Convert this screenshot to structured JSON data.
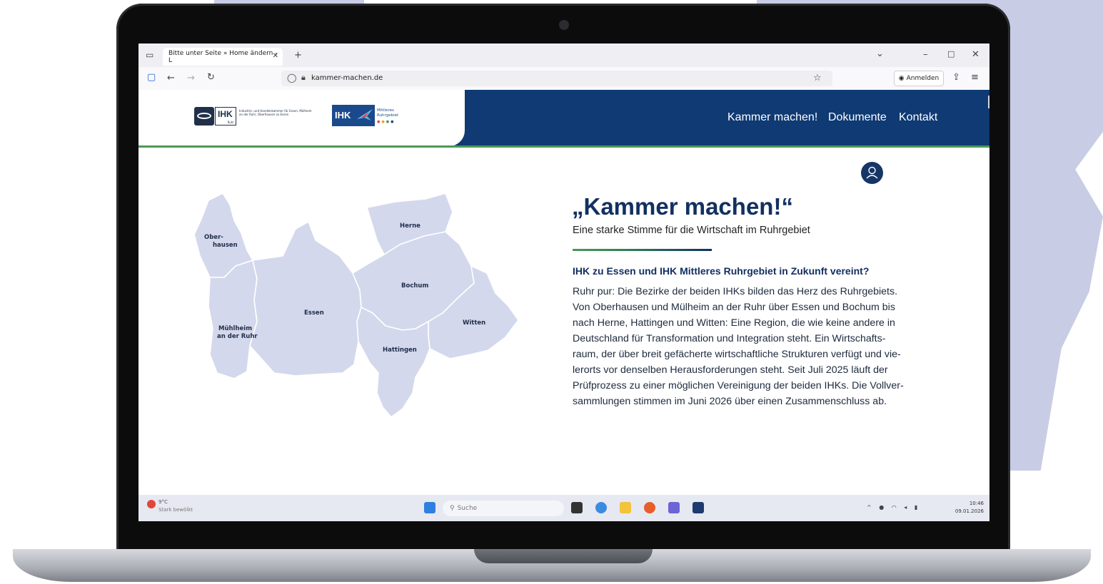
{
  "browser": {
    "tab_title": "Bitte unter Seite » Home ändern - L",
    "tab_close": "✕",
    "new_tab": "+",
    "url": "kammer-machen.de",
    "sign_in_label": "Anmelden",
    "window_controls": [
      "⌄",
      "–",
      "□",
      "✕"
    ]
  },
  "site": {
    "logo_ihk_ruhr": {
      "mark": "IHK",
      "sub": "Ruhr",
      "text": "Industrie- und Handelskammer für Essen, Mülheim an der Ruhr, Oberhausen zu Essen"
    },
    "logo_ihk_mittleres": {
      "mark": "IHK",
      "text_line1": "Mittleres",
      "text_line2": "Ruhrgebiet"
    },
    "nav": [
      "Kammer machen!",
      "Dokumente",
      "Kontakt"
    ],
    "hero": {
      "title": "„Kammer machen!“",
      "subtitle": "Eine starke Stimme für die Wirtschaft im Ruhrgebiet",
      "heading": "IHK zu Essen und IHK Mittleres Ruhrgebiet in Zukunft vereint?",
      "body_lines": [
        "Ruhr pur: Die Bezirke der beiden IHKs bilden das Herz des Ruhrgebiets.",
        "Von Oberhausen und Mülheim an der Ruhr über Essen und Bochum bis",
        "nach Herne, Hattingen und Witten: Eine Region, die wie keine andere in",
        "Deutschland für Transformation und Integration steht. Ein Wirtschafts-",
        "raum, der über breit gefächerte wirtschaftliche Strukturen verfügt und vie-",
        "lerorts vor denselben Herausforderungen steht. Seit Juli 2025 läuft der",
        "Prüfprozess zu einer möglichen Vereinigung der beiden IHKs. Die Vollver-",
        "sammlungen stimmen im Juni 2026 über einen Zusammenschluss ab."
      ]
    },
    "map": {
      "oberhausen_1": "Ober-",
      "oberhausen_2": "hausen",
      "muelheim_1": "Mühlheim",
      "muelheim_2": "an der Ruhr",
      "essen": "Essen",
      "herne": "Herne",
      "bochum": "Bochum",
      "witten": "Witten",
      "hattingen": "Hattingen"
    }
  },
  "taskbar": {
    "weather_temp": "9°C",
    "weather_desc": "Stark bewölkt",
    "search_placeholder": "Suche",
    "time": "10:46",
    "date": "09.01.2026"
  },
  "colors": {
    "header_bg": "#0f3a73",
    "accent_green": "#4a9a54",
    "title_navy": "#123061",
    "map_fill": "#d4d8ec"
  }
}
